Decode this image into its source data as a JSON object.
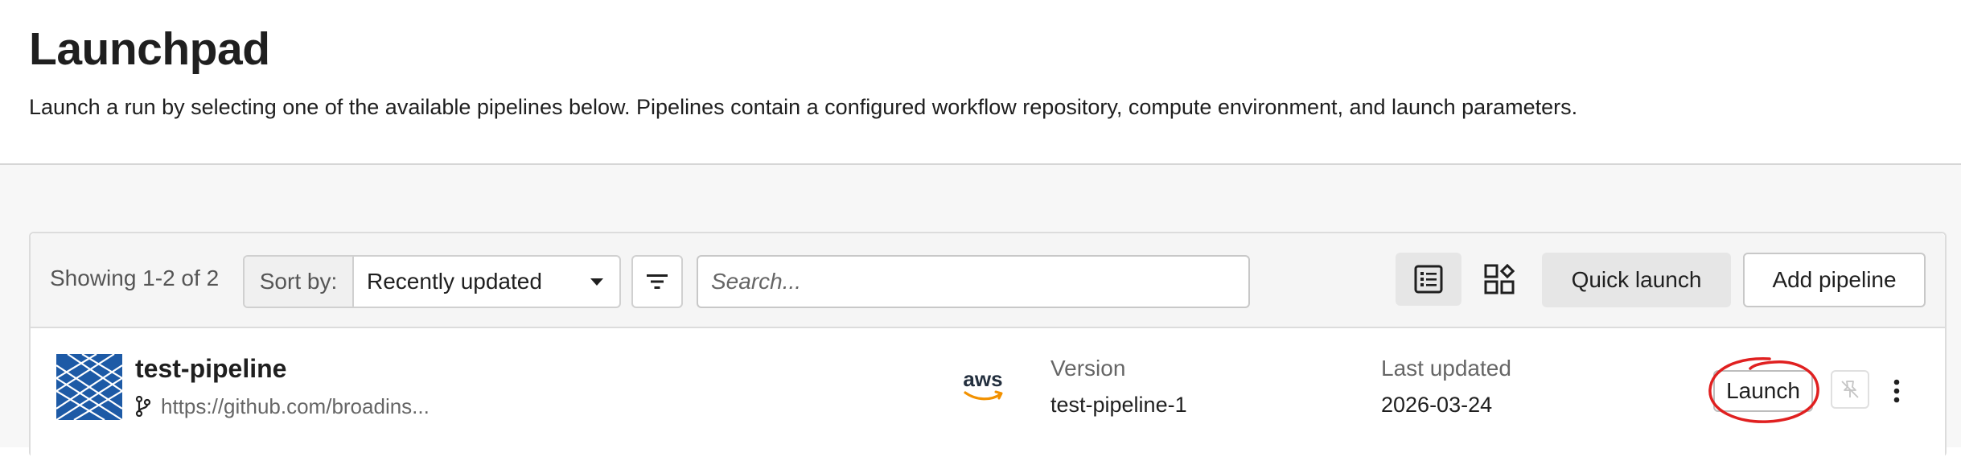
{
  "header": {
    "title": "Launchpad",
    "description": "Launch a run by selecting one of the available pipelines below. Pipelines contain a configured workflow repository, compute environment, and launch parameters."
  },
  "toolbar": {
    "showing": "Showing 1-2 of 2",
    "sort_label": "Sort by:",
    "sort_value": "Recently updated",
    "search_placeholder": "Search...",
    "quick_launch_label": "Quick launch",
    "add_pipeline_label": "Add pipeline",
    "active_view": "list"
  },
  "pipelines": [
    {
      "name": "test-pipeline",
      "repository": "https://github.com/broadins...",
      "platform": "aws",
      "version_label": "Version",
      "version": "test-pipeline-1",
      "updated_label": "Last updated",
      "updated": "2026-03-24",
      "launch_label": "Launch"
    }
  ],
  "colors": {
    "annotation_circle": "#e02020",
    "aws_orange": "#f29100",
    "logo_blue": "#1d5aa6"
  }
}
